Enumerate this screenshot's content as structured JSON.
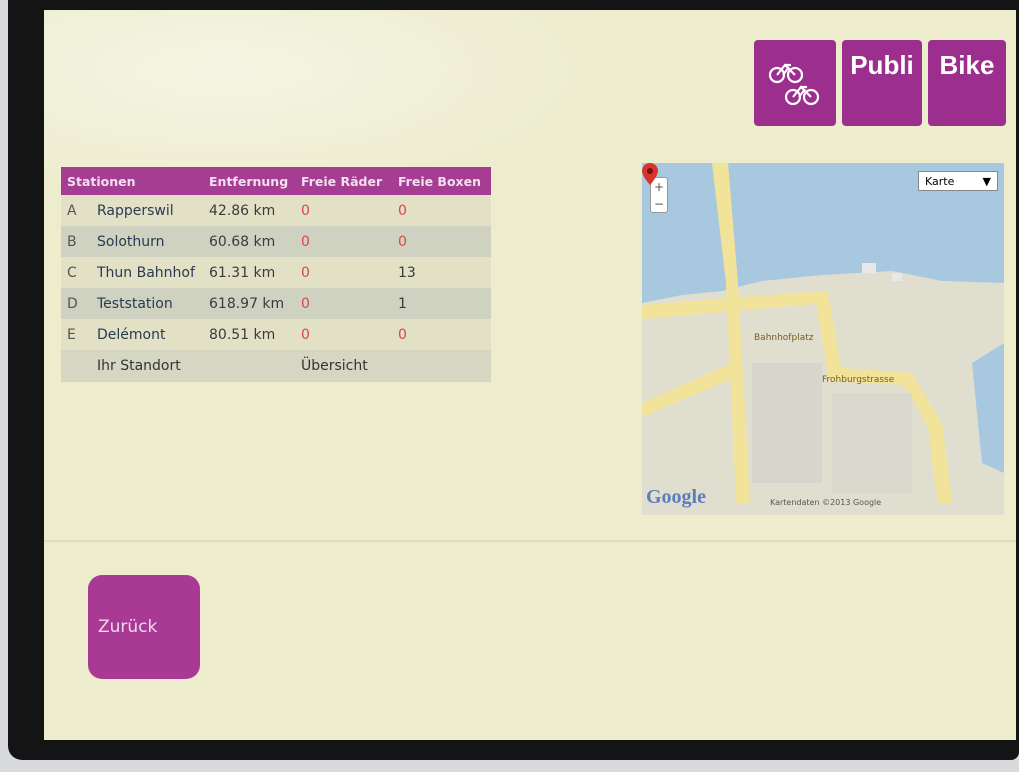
{
  "brand": {
    "icon": "bicycles-icon",
    "word1": "Publi",
    "word2": "Bike",
    "color": "#9c2f8e"
  },
  "table": {
    "headers": [
      "Stationen",
      "Entfernung",
      "Freie Räder",
      "Freie Boxen"
    ],
    "rows": [
      {
        "letter": "A",
        "name": "Rapperswil",
        "distance": "42.86 km",
        "bikes": "0",
        "boxes": "0"
      },
      {
        "letter": "B",
        "name": "Solothurn",
        "distance": "60.68 km",
        "bikes": "0",
        "boxes": "0"
      },
      {
        "letter": "C",
        "name": "Thun Bahnhof",
        "distance": "61.31 km",
        "bikes": "0",
        "boxes": "13"
      },
      {
        "letter": "D",
        "name": "Teststation",
        "distance": "618.97 km",
        "bikes": "0",
        "boxes": "1"
      },
      {
        "letter": "E",
        "name": "Delémont",
        "distance": "80.51 km",
        "bikes": "0",
        "boxes": "0"
      }
    ],
    "footer": {
      "location": "Ihr Standort",
      "overview": "Übersicht"
    }
  },
  "map": {
    "type_select": "Karte",
    "zoom_in": "+",
    "zoom_out": "−",
    "logo": "Google",
    "copyright": "Kartendaten ©2013 Google",
    "labels": {
      "bahnhofplatz": "Bahnhofplatz",
      "frohburgstrasse": "Frohburgstrasse"
    }
  },
  "back_button": "Zurück",
  "colors": {
    "accent": "#a53e92",
    "zero_red": "#d84848",
    "screen_bg": "#edeccd"
  }
}
